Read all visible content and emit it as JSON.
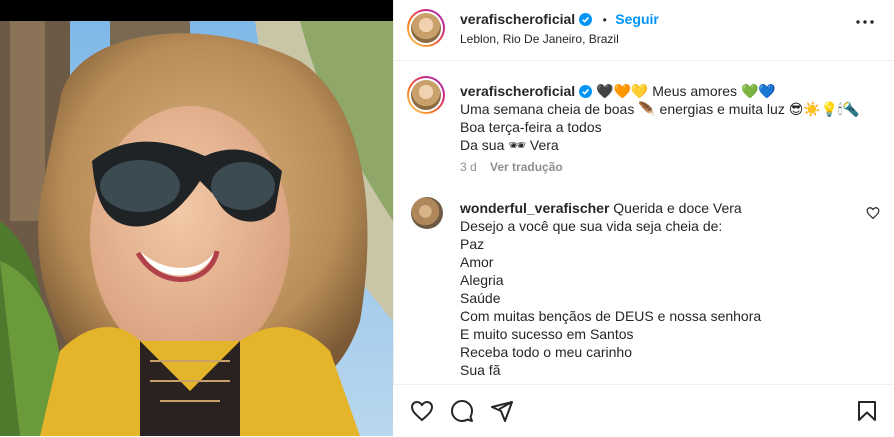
{
  "post": {
    "username": "verafischeroficial",
    "follow_label": "Seguir",
    "dot": "•",
    "location": "Leblon, Rio De Janeiro, Brazil",
    "more_label": "•••"
  },
  "caption": {
    "username": "verafischeroficial",
    "lines": [
      " 🖤🧡💛 Meus amores 💚💙",
      "Uma semana cheia de boas 🪶 energias e muita luz 😎☀️💡🕯🔦",
      "Boa terça-feira a todos",
      "Da sua 🕶 Vera"
    ],
    "time": "3 d",
    "translate_label": "Ver tradução"
  },
  "comment": {
    "username": "wonderful_verafischer",
    "lines": [
      " Querida e doce Vera",
      "Desejo a você que sua vida seja cheia de:",
      "Paz",
      "Amor",
      "Alegria",
      "Saúde",
      "Com muitas bençãos de DEUS e nossa senhora",
      "E muito sucesso em Santos",
      "Receba todo o meu carinho",
      "Sua fã"
    ]
  },
  "colors": {
    "accent": "#0095f6",
    "verified": "#0095f6",
    "muted": "#8e8e8e",
    "text": "#262626"
  },
  "icons": [
    "heart-icon",
    "comment-icon",
    "share-icon",
    "bookmark-icon",
    "verified-badge-icon",
    "more-icon"
  ]
}
